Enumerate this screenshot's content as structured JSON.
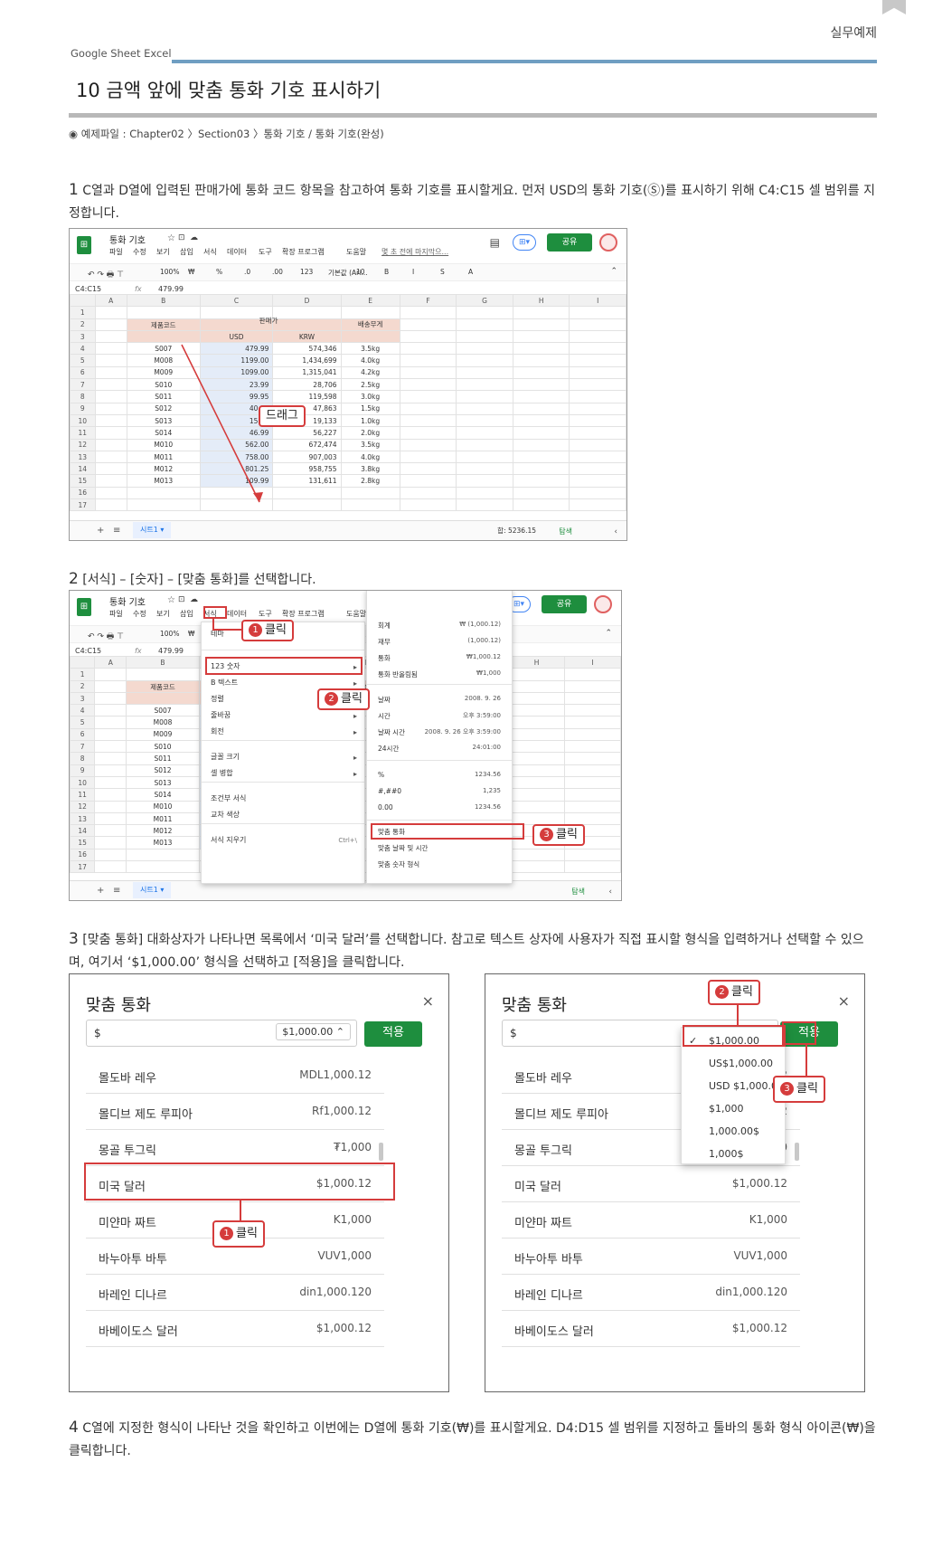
{
  "header": {
    "section_label": "실무예제",
    "brand": "Google Sheet  Excel",
    "title": "10 금액 앞에 맞춤 통화 기호 표시하기",
    "example_file": "◉ 예제파일 : Chapter02 〉Section03 〉통화 기호 / 통화 기호(완성)"
  },
  "steps": {
    "s1": {
      "num": "1",
      "text": " C열과 D열에 입력된 판매가에 통화 코드 항목을 참고하여 통화 기호를 표시할게요. 먼저 USD의 통화 기호(Ⓢ)를 표시하기 위해 C4:C15 셀 범위를 지정합니다."
    },
    "s2": {
      "num": "2",
      "text": " [서식] – [숫자] – [맞춤 통화]를 선택합니다."
    },
    "s3": {
      "num": "3",
      "text": " [맞춤 통화] 대화상자가 나타나면 목록에서 ‘미국 달러’를 선택합니다. 참고로 텍스트 상자에 사용자가 직접 표시할 형식을 입력하거나 선택할 수 있으며, 여기서 ‘$1,000.00’ 형식을 선택하고 [적용]을 클릭합니다."
    },
    "s4": {
      "num": "4",
      "text": " C열에 지정한 형식이 나타난 것을 확인하고 이번에는 D열에 통화 기호(₩)를 표시할게요. D4:D15 셀 범위를 지정하고 툴바의 통화 형식 아이콘(₩)을 클릭합니다."
    }
  },
  "sheet": {
    "doc_title": "통화 기호",
    "menus": [
      "파일",
      "수정",
      "보기",
      "삽입",
      "서식",
      "데이터",
      "도구",
      "확장 프로그램",
      "도움말"
    ],
    "last_edit": "몇 초 전에 마지막으...",
    "share": "공유",
    "toolbar": [
      "100%",
      "₩",
      "%",
      ".0",
      ".00",
      "123",
      "기본값 (Ari...",
      "10",
      "B",
      "I",
      "S",
      "A"
    ],
    "cell_ref": "C4:C15",
    "formula": "479.99",
    "cols": [
      "A",
      "B",
      "C",
      "D",
      "E",
      "F",
      "G",
      "H",
      "I"
    ],
    "header_code": "제품코드",
    "header_price": "판매가",
    "header_usd": "USD",
    "header_krw": "KRW",
    "header_weight": "배송무게",
    "rows": [
      [
        "S007",
        "479.99",
        "574,346",
        "3.5kg"
      ],
      [
        "M008",
        "1199.00",
        "1,434,699",
        "4.0kg"
      ],
      [
        "M009",
        "1099.00",
        "1,315,041",
        "4.2kg"
      ],
      [
        "S010",
        "23.99",
        "28,706",
        "2.5kg"
      ],
      [
        "S011",
        "99.95",
        "119,598",
        "3.0kg"
      ],
      [
        "S012",
        "40.00",
        "47,863",
        "1.5kg"
      ],
      [
        "S013",
        "15.99",
        "19,133",
        "1.0kg"
      ],
      [
        "S014",
        "46.99",
        "56,227",
        "2.0kg"
      ],
      [
        "M010",
        "562.00",
        "672,474",
        "3.5kg"
      ],
      [
        "M011",
        "758.00",
        "907,003",
        "4.0kg"
      ],
      [
        "M012",
        "801.25",
        "958,755",
        "3.8kg"
      ],
      [
        "M013",
        "109.99",
        "131,611",
        "2.8kg"
      ]
    ],
    "sheet_tab": "시트1",
    "sum": "합: 5236.15",
    "explore": "탐색",
    "drag_label": "드래그"
  },
  "menu2": {
    "format_items": [
      "테마",
      "123 숫자",
      "B 텍스트",
      "정렬",
      "줄바꿈",
      "회전",
      "글꼴 크기",
      "셀 병합",
      "조건부 서식",
      "교차 색상",
      "서식 지우기"
    ],
    "clear_shortcut": "Ctrl+\\",
    "number_items": [
      [
        "회계",
        "₩ (1,000.12)"
      ],
      [
        "재무",
        "(1,000.12)"
      ],
      [
        "통화",
        "₩1,000.12"
      ],
      [
        "통화 반올림됨",
        "₩1,000"
      ],
      [
        "날짜",
        "2008. 9. 26"
      ],
      [
        "시간",
        "오후 3:59:00"
      ],
      [
        "날짜 시간",
        "2008. 9. 26 오후 3:59:00"
      ],
      [
        "24시간",
        "24:01:00"
      ],
      [
        "%",
        "1234.56"
      ],
      [
        "#,##0",
        "1,235"
      ],
      [
        "0.00",
        "1234.56"
      ]
    ],
    "custom_items": [
      "맞춤 통화",
      "맞춤 날짜 및 시간",
      "맞춤 숫자 형식"
    ],
    "click": "클릭"
  },
  "dialog": {
    "title": "맞춤 통화",
    "close": "×",
    "input": "$",
    "format": "$1,000.00 ⌃",
    "apply": "적용",
    "rows": [
      [
        "몰도바 레우",
        "MDL1,000.12"
      ],
      [
        "몰디브 제도 루피아",
        "Rf1,000.12"
      ],
      [
        "몽골 투그릭",
        "₮1,000"
      ],
      [
        "미국 달러",
        "$1,000.12"
      ],
      [
        "미얀마 짜트",
        "K1,000"
      ],
      [
        "바누아투 바투",
        "VUV1,000"
      ],
      [
        "바레인 디나르",
        "din1,000.120"
      ],
      [
        "바베이도스 달러",
        "$1,000.12"
      ]
    ],
    "formats": [
      "$1,000.00",
      "US$1,000.00",
      "USD $1,000.00",
      "$1,000",
      "1,000.00$",
      "1,000$"
    ]
  }
}
